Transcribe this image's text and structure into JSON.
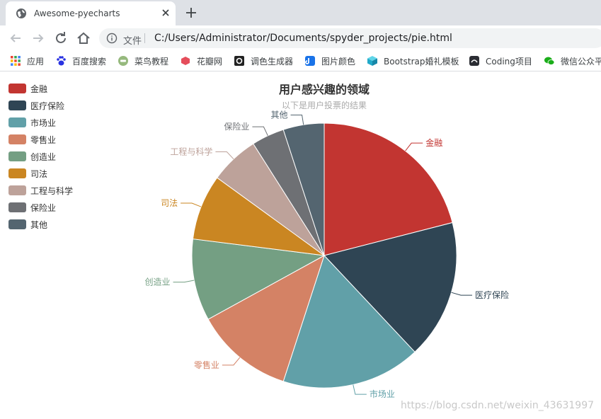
{
  "tab": {
    "title": "Awesome-pyecharts"
  },
  "address": {
    "scheme_label": "文件",
    "url": "C:/Users/Administrator/Documents/spyder_projects/pie.html"
  },
  "bookmarks": [
    {
      "label": "应用",
      "icon": "apps-grid-icon"
    },
    {
      "label": "百度搜索",
      "icon": "baidu-paw-icon"
    },
    {
      "label": "菜鸟教程",
      "icon": "runoob-icon"
    },
    {
      "label": "花瓣网",
      "icon": "huaban-icon"
    },
    {
      "label": "调色生成器",
      "icon": "color-generator-icon"
    },
    {
      "label": "图片颜色",
      "icon": "image-color-icon"
    },
    {
      "label": "Bootstrap婚礼模板",
      "icon": "bootstrap-cube-icon"
    },
    {
      "label": "Coding项目",
      "icon": "coding-icon"
    },
    {
      "label": "微信公众平",
      "icon": "wechat-icon"
    }
  ],
  "watermark": "https://blog.csdn.net/weixin_43631997",
  "chart_data": {
    "type": "pie",
    "title": "用户感兴趣的领域",
    "subtitle": "以下是用户投票的结果",
    "legend_position": "top-left",
    "categories": [
      "金融",
      "医疗保险",
      "市场业",
      "零售业",
      "创造业",
      "司法",
      "工程与科学",
      "保险业",
      "其他"
    ],
    "values": [
      21,
      17,
      17,
      12,
      10,
      8,
      6,
      4,
      5
    ],
    "colors": [
      "#c23531",
      "#2f4554",
      "#61a0a8",
      "#d48265",
      "#749f83",
      "#ca8622",
      "#bda29a",
      "#6e7074",
      "#546570"
    ]
  }
}
